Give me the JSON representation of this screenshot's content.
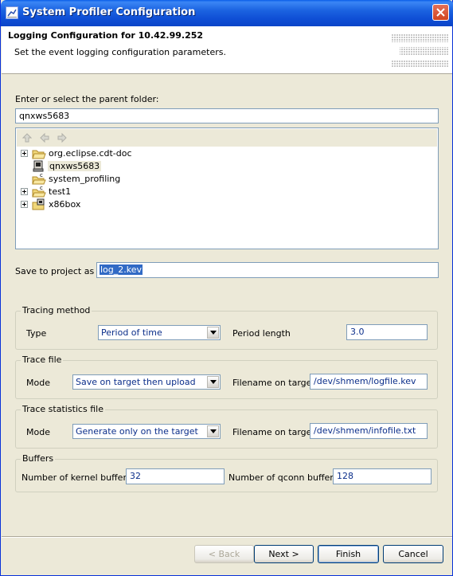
{
  "window": {
    "title": "System Profiler Configuration"
  },
  "banner": {
    "title": "Logging Configuration for 10.42.99.252",
    "subtitle": "Set the event logging configuration parameters."
  },
  "folder": {
    "label": "Enter or select the parent folder:",
    "value": "qnxws5683"
  },
  "tree": {
    "items": [
      {
        "label": "org.eclipse.cdt-doc",
        "expandable": true,
        "icon": "folder-icon"
      },
      {
        "label": "qnxws5683",
        "expandable": false,
        "icon": "target-project-icon",
        "selected": true
      },
      {
        "label": "system_profiling",
        "expandable": false,
        "icon": "c-project-folder-icon"
      },
      {
        "label": "test1",
        "expandable": true,
        "icon": "c-project-folder-icon"
      },
      {
        "label": "x86box",
        "expandable": true,
        "icon": "target-project-icon"
      }
    ]
  },
  "save_project": {
    "label": "Save to project as :",
    "value": "log_2.kev"
  },
  "tracing": {
    "group": "Tracing method",
    "type_label": "Type",
    "type_value": "Period of time",
    "period_label": "Period length",
    "period_value": "3.0"
  },
  "trace_file": {
    "group": "Trace file",
    "mode_label": "Mode",
    "mode_value": "Save on target then upload",
    "filename_label": "Filename on target",
    "filename_value": "/dev/shmem/logfile.kev"
  },
  "stats_file": {
    "group": "Trace statistics file",
    "mode_label": "Mode",
    "mode_value": "Generate only on the target",
    "filename_label": "Filename on target",
    "filename_value": "/dev/shmem/infofile.txt"
  },
  "buffers": {
    "group": "Buffers",
    "kernel_label": "Number of kernel buffers",
    "kernel_value": "32",
    "qconn_label": "Number of qconn buffers",
    "qconn_value": "128"
  },
  "buttons": {
    "back": "< Back",
    "next": "Next >",
    "finish": "Finish",
    "cancel": "Cancel"
  },
  "colors": {
    "titlebar": "#0f4fd6",
    "dialog_bg": "#ece9d8",
    "selection": "#316ac5"
  }
}
